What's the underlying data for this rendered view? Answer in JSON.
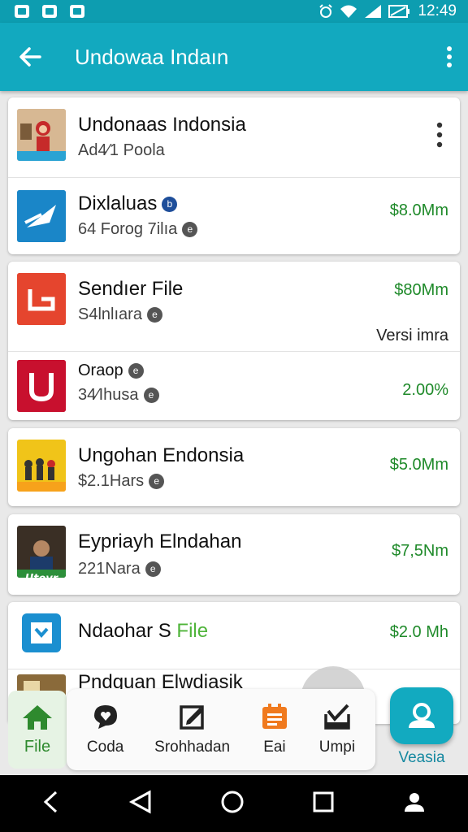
{
  "status_bar": {
    "time": "12:49"
  },
  "app_bar": {
    "title": "Undowaa Indaın"
  },
  "items": [
    {
      "name": "Undonaas Indonsia",
      "sub": "Ad4⁄1 Poola",
      "price": ""
    },
    {
      "name": "Dixlaluas",
      "sub": "64 Forog 7ilıa",
      "price": "$8.0Mm"
    },
    {
      "name": "Sendıer File",
      "sub": "S4lnlıara",
      "price": "$80Mm",
      "extra": "Versi imra"
    },
    {
      "name": "Oraop",
      "sub": "34⁄Ihusa",
      "price": "2.00%"
    },
    {
      "name": "Ungohan Endonsia",
      "sub": "$2.1Hars",
      "price": "$5.0Mm"
    },
    {
      "name": "Eypriayh Elndahan",
      "sub": "221Nara",
      "price": "$7,5Nm"
    },
    {
      "name_part1": "Ndaohar S",
      "name_part2": "File",
      "price": "$2.0 Mh"
    },
    {
      "name": "Pndguan Elwdiasik"
    }
  ],
  "bottom_tabs": [
    {
      "label": "File",
      "icon": "home-icon"
    },
    {
      "label": "Coda",
      "icon": "chat-heart-icon"
    },
    {
      "label": "Srohhadan",
      "icon": "edit-box-icon"
    },
    {
      "label": "Eai",
      "icon": "calendar-doc-icon"
    },
    {
      "label": "Umpi",
      "icon": "download-check-icon"
    },
    {
      "label": "Veasia",
      "icon": "person-icon"
    }
  ],
  "colors": {
    "primary": "#12a9bf",
    "price_green": "#1f8a2a"
  }
}
